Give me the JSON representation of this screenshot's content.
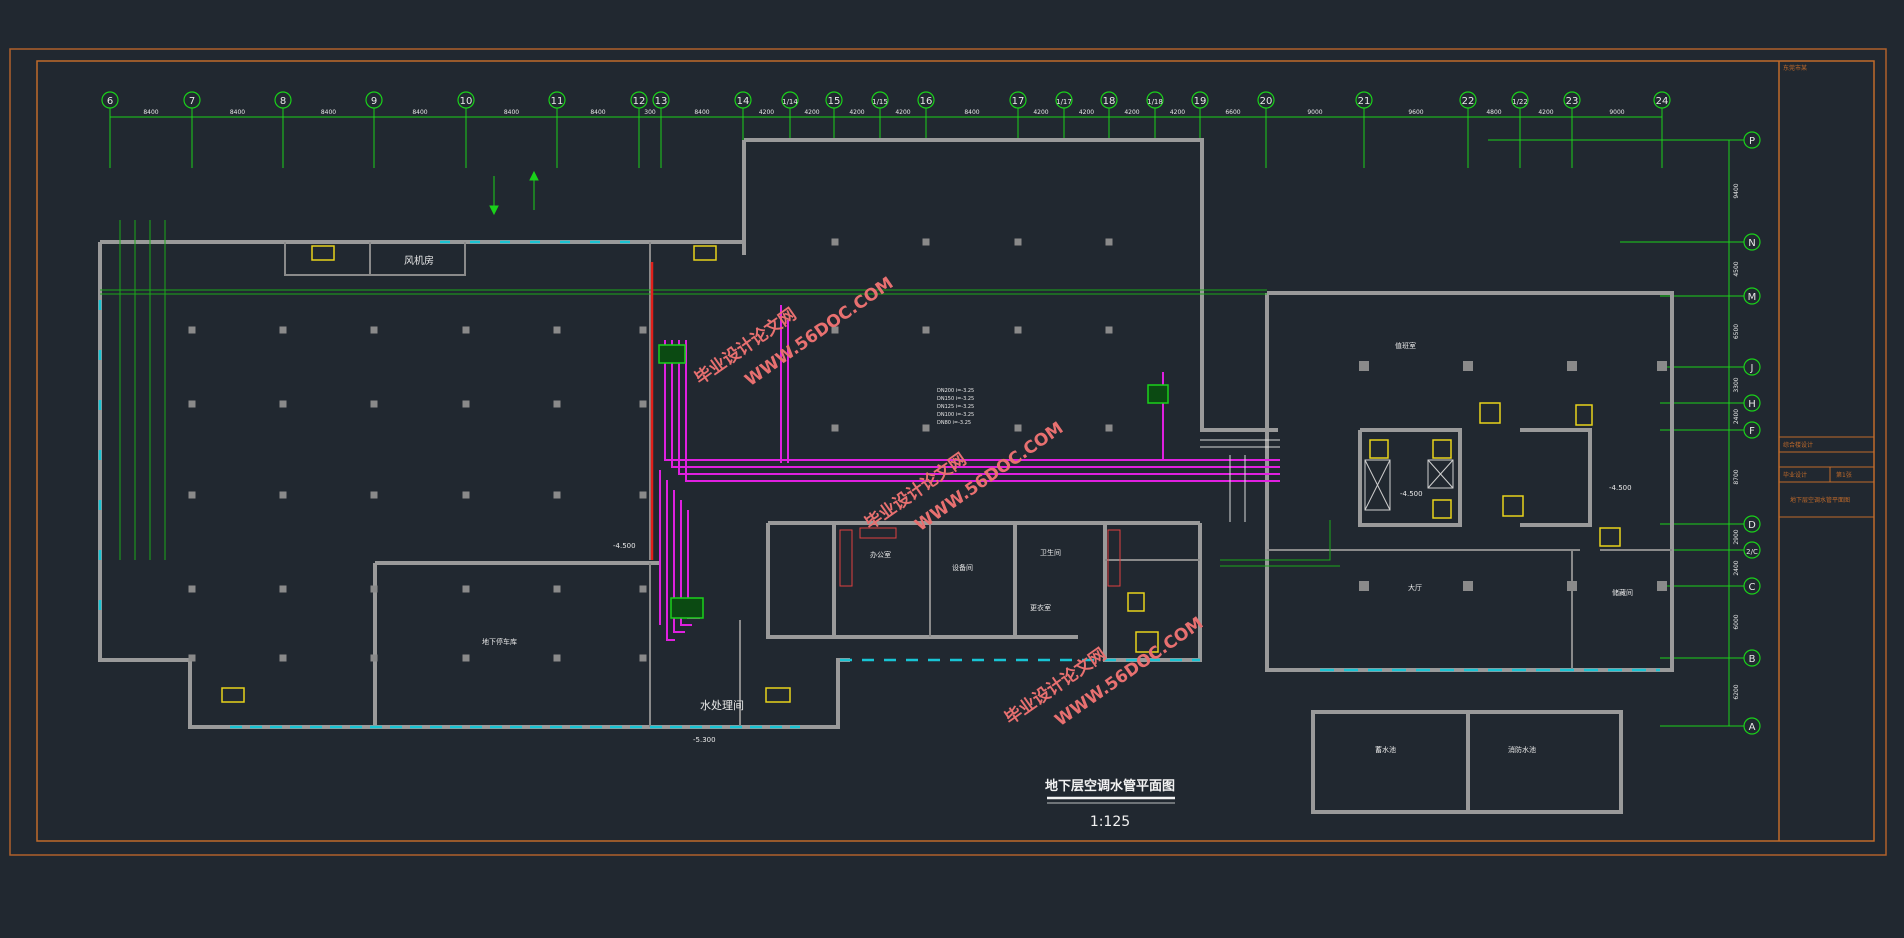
{
  "drawing": {
    "title": "地下层空调水管平面图",
    "scale": "1:125",
    "watermarks": [
      {
        "line1": "毕业设计论文网",
        "line2": "WWW.56DOC.COM"
      }
    ]
  },
  "grid": {
    "col_labels": [
      "6",
      "7",
      "8",
      "9",
      "10",
      "11",
      "12",
      "13",
      "14",
      "1/14",
      "15",
      "1/15",
      "16",
      "17",
      "1/17",
      "18",
      "1/18",
      "19",
      "20",
      "21",
      "22",
      "1/22",
      "23",
      "24"
    ],
    "col_dims": [
      "8400",
      "8400",
      "8400",
      "8400",
      "8400",
      "8400",
      "300",
      "8400",
      "4200",
      "4200",
      "4200",
      "4200",
      "8400",
      "4200",
      "4200",
      "4200",
      "4200",
      "6600",
      "9000",
      "9600",
      "4800",
      "4200",
      "9000"
    ],
    "row_labels": [
      "P",
      "N",
      "M",
      "J",
      "H",
      "F",
      "D",
      "2/C",
      "C",
      "B",
      "A"
    ],
    "row_dims": [
      "9400",
      "4500",
      "6500",
      "3300",
      "2400",
      "8700",
      "2900",
      "2400",
      "6000",
      "6200"
    ]
  },
  "rooms": {
    "fan_room": "风机房",
    "water_pump_room": "水处理间",
    "main_hall": "地下停车库",
    "office": "办公室",
    "equipment_room": "设备间",
    "sub_room_a": "卫生间",
    "sub_room_b": "更衣室",
    "right_hall": "大厅",
    "right_office": "值班室",
    "right_store": "储藏间",
    "bottom_left_box": "蓄水池",
    "bottom_right_box": "消防水池"
  },
  "elevations": {
    "e1": "-5.300",
    "e2": "-4.500",
    "e3": "-4.500",
    "e4": "-4.500"
  },
  "pipe_notes": {
    "n1": "DN200 i=-3.25",
    "n2": "DN150 i=-3.25",
    "n3": "DN125 i=-3.25",
    "n4": "DN100 i=-3.25",
    "n5": "DN80 i=-3.25"
  },
  "title_block": {
    "header": "东莞市某",
    "project": "综合楼设计",
    "sheet_no": "第1张",
    "drawing_name": "地下层空调水管平面图",
    "drawer": "毕业设计"
  }
}
